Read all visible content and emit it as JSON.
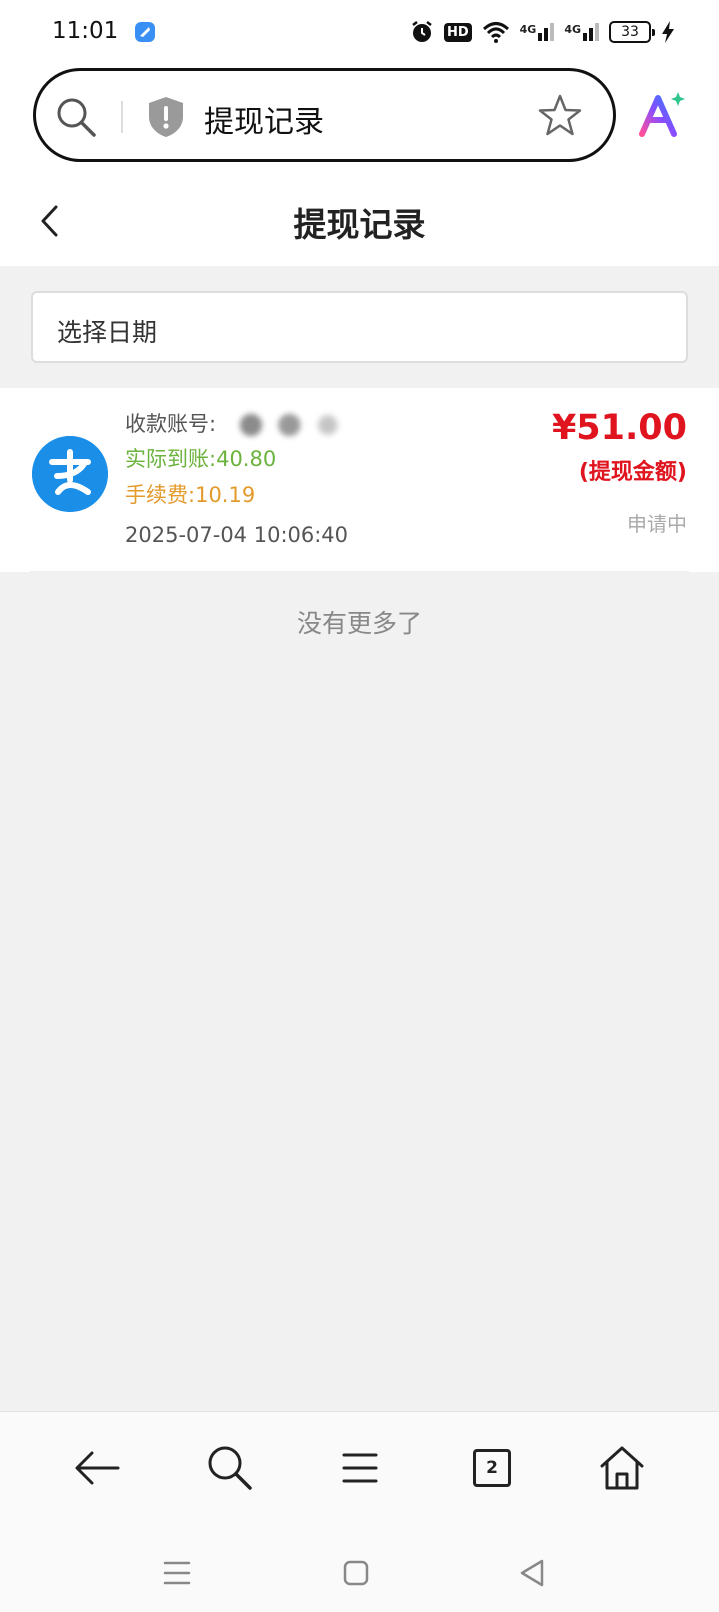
{
  "status_bar": {
    "time": "11:01",
    "battery": "33",
    "hd_label": "HD",
    "network_1": "4G",
    "network_2": "4G"
  },
  "browser": {
    "address_text": "提现记录",
    "icons": [
      "search-icon",
      "shield-icon",
      "star-icon",
      "ai-icon"
    ]
  },
  "page": {
    "title": "提现记录",
    "date_filter_placeholder": "选择日期"
  },
  "records": [
    {
      "account_label": "收款账号:",
      "actual_label": "实际到账:",
      "actual_value": "40.80",
      "fee_label": "手续费:",
      "fee_value": "10.19",
      "time": "2025-07-04 10:06:40",
      "amount": "¥51.00",
      "amount_label": "(提现金额)",
      "status": "申请中"
    }
  ],
  "footer": {
    "no_more_text": "没有更多了"
  },
  "bottom_nav": {
    "tab_count": "2"
  },
  "colors": {
    "amount_red": "#e0141e",
    "actual_green": "#6cb33e",
    "fee_orange": "#e39a2b",
    "alipay_blue": "#1b8fe8"
  }
}
